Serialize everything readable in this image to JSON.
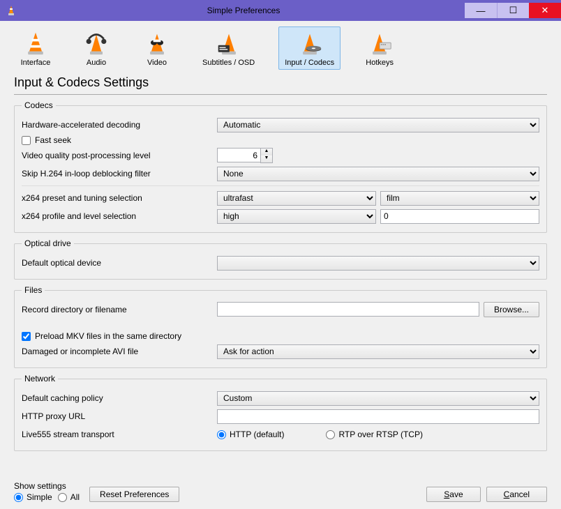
{
  "titlebar": {
    "title": "Simple Preferences"
  },
  "categories": [
    {
      "label": "Interface"
    },
    {
      "label": "Audio"
    },
    {
      "label": "Video"
    },
    {
      "label": "Subtitles / OSD"
    },
    {
      "label": "Input / Codecs"
    },
    {
      "label": "Hotkeys"
    }
  ],
  "page_title": "Input & Codecs Settings",
  "sections": {
    "codecs": {
      "legend": "Codecs",
      "hw_decoding_label": "Hardware-accelerated decoding",
      "hw_decoding_value": "Automatic",
      "fast_seek_label": "Fast seek",
      "fast_seek_checked": false,
      "video_quality_label": "Video quality post-processing level",
      "video_quality_value": "6",
      "skip_h264_label": "Skip H.264 in-loop deblocking filter",
      "skip_h264_value": "None",
      "x264_preset_label": "x264 preset and tuning selection",
      "x264_preset_value": "ultrafast",
      "x264_tuning_value": "film",
      "x264_profile_label": "x264 profile and level selection",
      "x264_profile_value": "high",
      "x264_level_value": "0"
    },
    "optical": {
      "legend": "Optical drive",
      "default_device_label": "Default optical device",
      "default_device_value": ""
    },
    "files": {
      "legend": "Files",
      "record_dir_label": "Record directory or filename",
      "record_dir_value": "",
      "browse_label": "Browse...",
      "preload_mkv_label": "Preload MKV files in the same directory",
      "preload_mkv_checked": true,
      "avi_label": "Damaged or incomplete AVI file",
      "avi_value": "Ask for action"
    },
    "network": {
      "legend": "Network",
      "caching_label": "Default caching policy",
      "caching_value": "Custom",
      "proxy_label": "HTTP proxy URL",
      "proxy_value": "",
      "live555_label": "Live555 stream transport",
      "live555_http": "HTTP (default)",
      "live555_rtp": "RTP over RTSP (TCP)",
      "live555_selected": "http"
    }
  },
  "footer": {
    "show_settings_title": "Show settings",
    "simple_label": "Simple",
    "all_label": "All",
    "reset_label": "Reset Preferences",
    "save_label": "Save",
    "cancel_label": "Cancel"
  }
}
